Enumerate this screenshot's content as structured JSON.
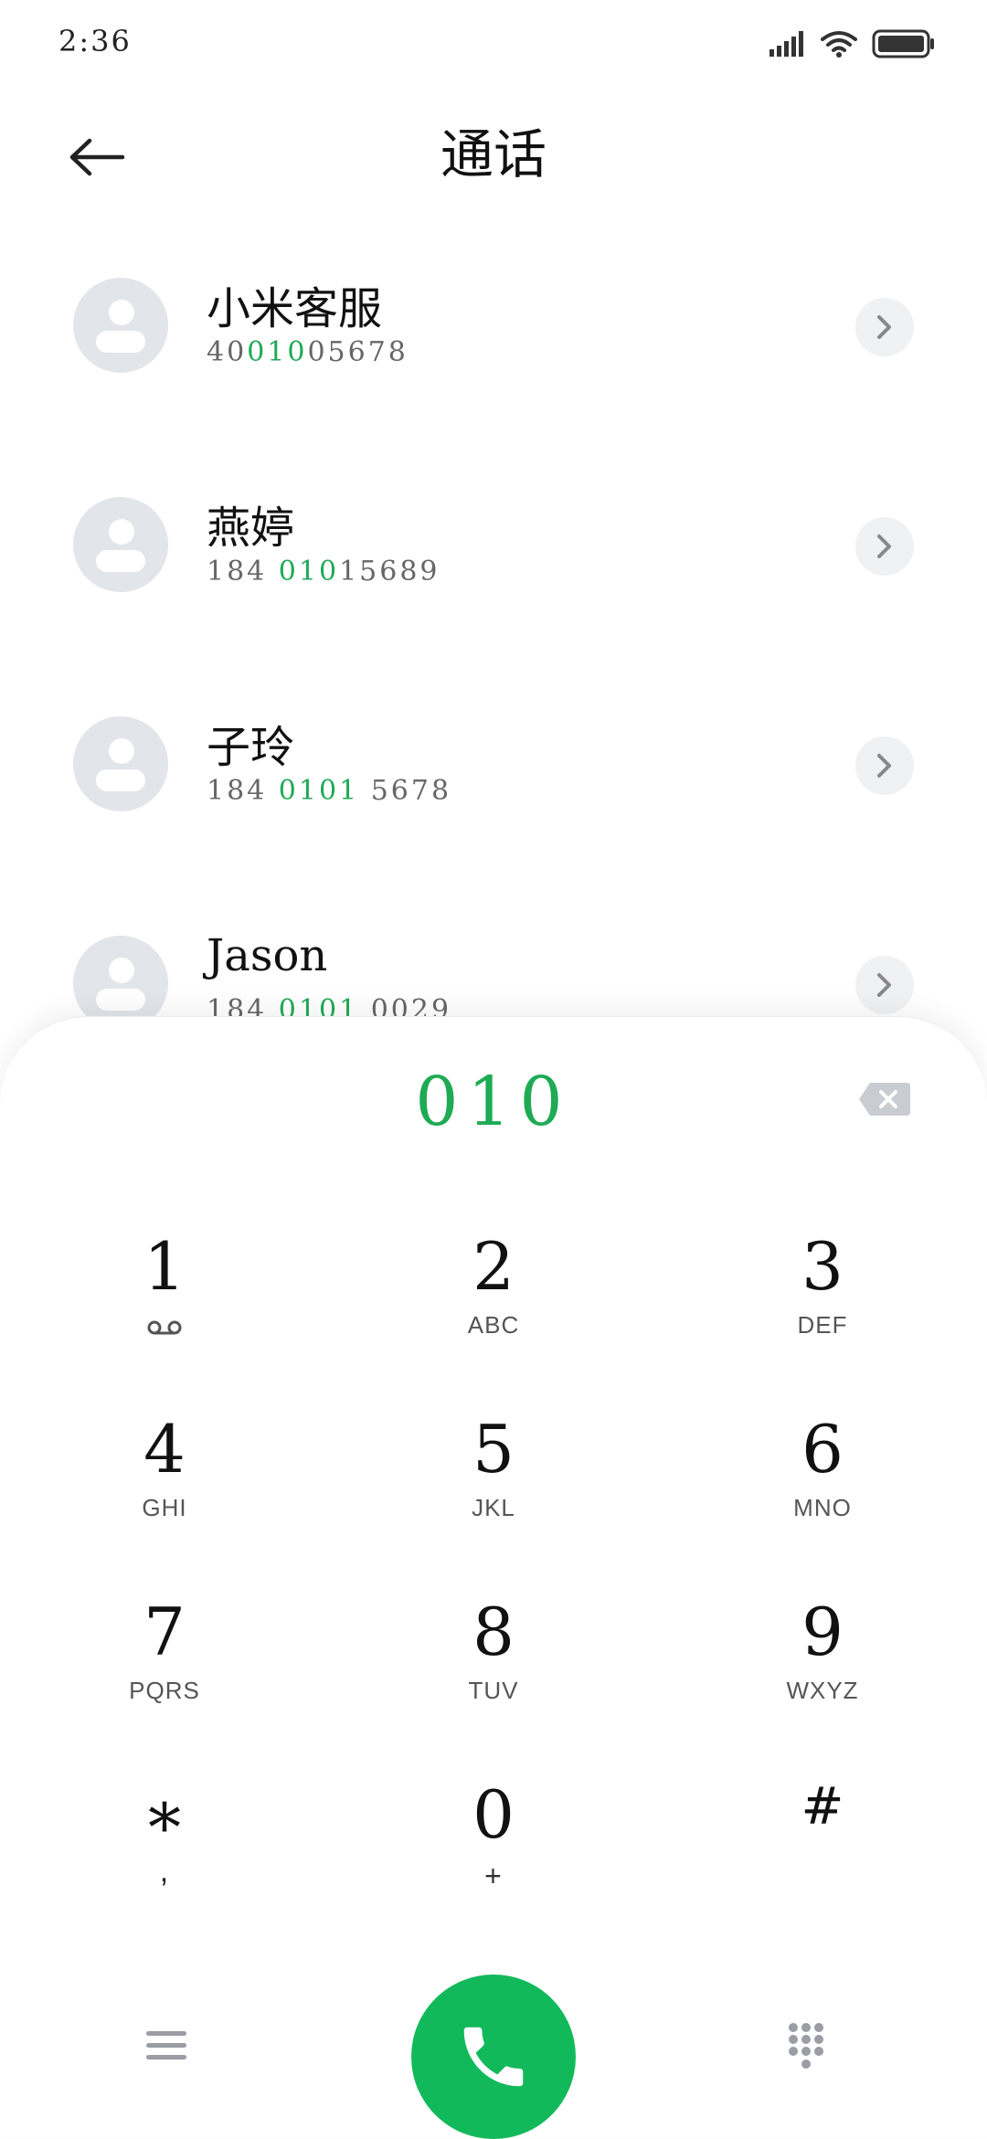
{
  "status_bar": {
    "time": "2:36",
    "icons": [
      "signal-icon",
      "wifi-icon",
      "battery-icon"
    ]
  },
  "header": {
    "title": "通话",
    "back_icon": "back-arrow-icon"
  },
  "contacts": [
    {
      "name": "小米客服",
      "number_pre": "40",
      "number_hl": "010",
      "number_post": "05678"
    },
    {
      "name": "燕婷",
      "number_pre": "184 ",
      "number_hl": "010",
      "number_post": "15689"
    },
    {
      "name": "子玲",
      "number_pre": "184 ",
      "number_hl": "0101",
      "number_post": " 5678"
    },
    {
      "name": "Jason",
      "number_pre": "184 ",
      "number_hl": "0101",
      "number_post": " 0029"
    }
  ],
  "dialer": {
    "display": "010",
    "keys": [
      {
        "digit": "1",
        "letters": ""
      },
      {
        "digit": "2",
        "letters": "ABC"
      },
      {
        "digit": "3",
        "letters": "DEF"
      },
      {
        "digit": "4",
        "letters": "GHI"
      },
      {
        "digit": "5",
        "letters": "JKL"
      },
      {
        "digit": "6",
        "letters": "MNO"
      },
      {
        "digit": "7",
        "letters": "PQRS"
      },
      {
        "digit": "8",
        "letters": "TUV"
      },
      {
        "digit": "9",
        "letters": "WXYZ"
      },
      {
        "digit": "*",
        "letters": ","
      },
      {
        "digit": "0",
        "letters": "+"
      },
      {
        "digit": "#",
        "letters": ""
      }
    ]
  },
  "colors": {
    "accent_green": "#1faa55",
    "call_button": "#12b95a",
    "avatar_bg": "#e2e5ea"
  }
}
